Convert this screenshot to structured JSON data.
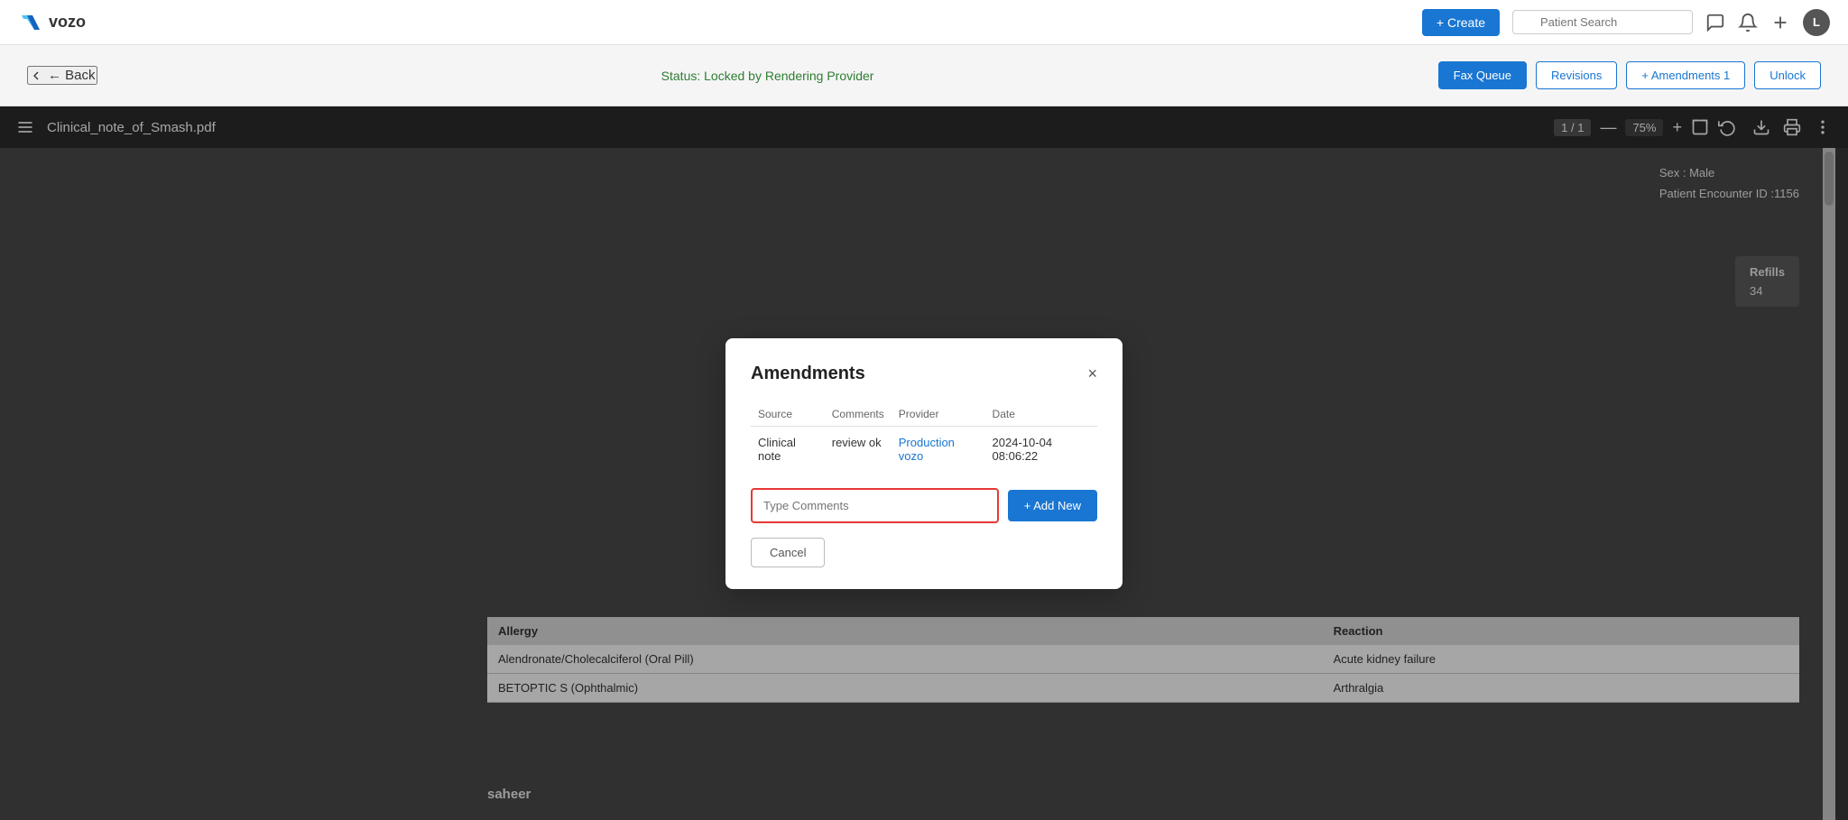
{
  "app": {
    "logo_text": "vozo",
    "logo_icon": "V"
  },
  "nav": {
    "create_label": "+ Create",
    "search_placeholder": "Patient Search",
    "avatar_label": "L"
  },
  "page": {
    "back_label": "← Back",
    "status_text": "Status: Locked by Rendering Provider",
    "actions": {
      "fax_queue": "Fax Queue",
      "revisions": "Revisions",
      "amendments": "+ Amendments 1",
      "unlock": "Unlock"
    }
  },
  "pdf": {
    "title": "Clinical_note_of_Smash.pdf",
    "page_current": "1",
    "page_total": "1",
    "zoom": "75%",
    "sex_label": "Sex : Male",
    "patient_encounter_label": "Patient Encounter ID :",
    "patient_encounter_id": "1156",
    "refills_label": "Refills",
    "refills_value": "34",
    "saheer_text": "saheer",
    "allergy_col1": "Allergy",
    "allergy_col2": "Reaction",
    "allergies": [
      {
        "allergy": "Alendronate/Cholecalciferol (Oral Pill)",
        "reaction": "Acute kidney failure"
      },
      {
        "allergy": "BETOPTIC S (Ophthalmic)",
        "reaction": "Arthralgia"
      }
    ]
  },
  "modal": {
    "title": "Amendments",
    "close_label": "×",
    "table": {
      "col_source": "Source",
      "col_comments": "Comments",
      "col_provider": "Provider",
      "col_date": "Date",
      "rows": [
        {
          "source": "Clinical note",
          "comments": "review ok",
          "provider": "Production vozo",
          "date": "2024-10-04 08:06:22"
        }
      ]
    },
    "comment_placeholder": "Type Comments",
    "add_new_label": "+ Add New",
    "cancel_label": "Cancel"
  }
}
